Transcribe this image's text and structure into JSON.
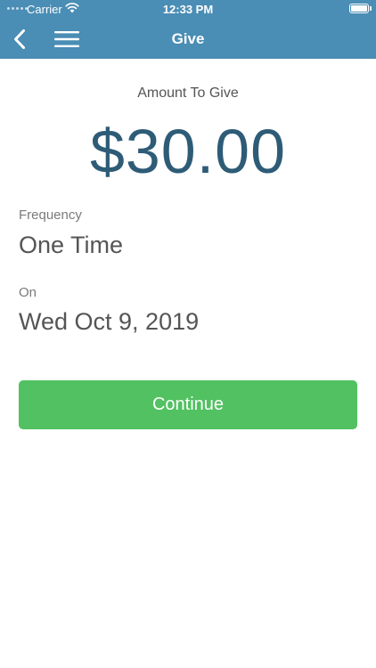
{
  "status_bar": {
    "carrier": "Carrier",
    "time": "12:33 PM",
    "battery_level": 1.0
  },
  "nav": {
    "title": "Give",
    "back_icon": "chevron-left-icon",
    "menu_icon": "hamburger-menu-icon"
  },
  "give": {
    "amount_label": "Amount To Give",
    "amount": "$30.00",
    "frequency_label": "Frequency",
    "frequency_value": "One Time",
    "date_label": "On",
    "date_value": "Wed Oct 9, 2019",
    "continue_label": "Continue"
  },
  "colors": {
    "header_bg": "#4a8db5",
    "amount": "#2e5c77",
    "continue_bg": "#52c162"
  }
}
